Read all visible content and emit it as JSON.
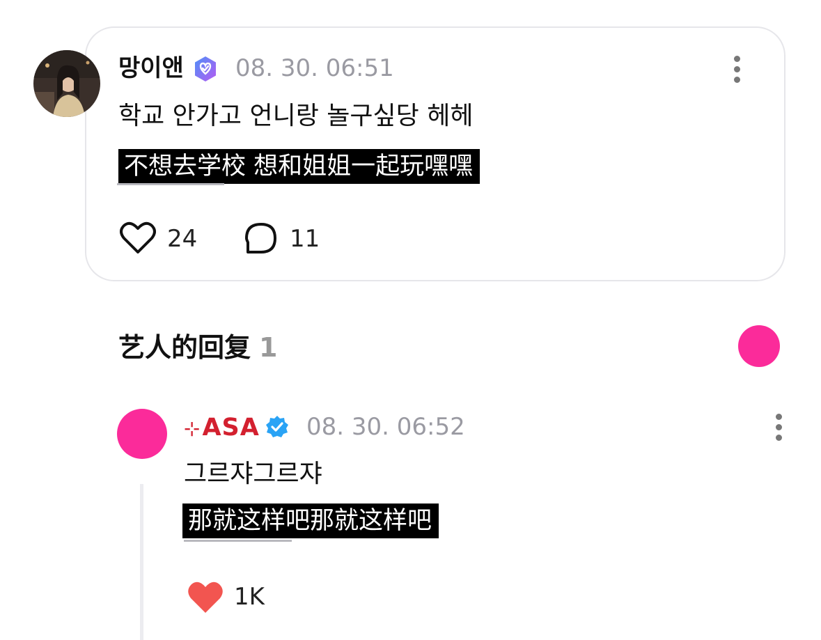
{
  "post": {
    "username": "망이앤",
    "timestamp": "08. 30. 06:51",
    "text": "학교 안가고 언니랑 놀구싶당 헤헤",
    "subtitle": "不想去学校 想和姐姐一起玩嘿嘿",
    "likes": "24",
    "comments": "11"
  },
  "artist_reply": {
    "title": "艺人的回复",
    "count": "1"
  },
  "reply": {
    "spark": "⊹",
    "username": "ASA",
    "timestamp": "08. 30. 06:52",
    "text": "그르쟈그르쟈",
    "subtitle": "那就这样吧那就这样吧",
    "likes": "1K"
  },
  "colors": {
    "accent_pink": "#fb2b9a",
    "verified_blue": "#2aa3f5",
    "like_red": "#f25550",
    "asa_red": "#d3202f"
  }
}
